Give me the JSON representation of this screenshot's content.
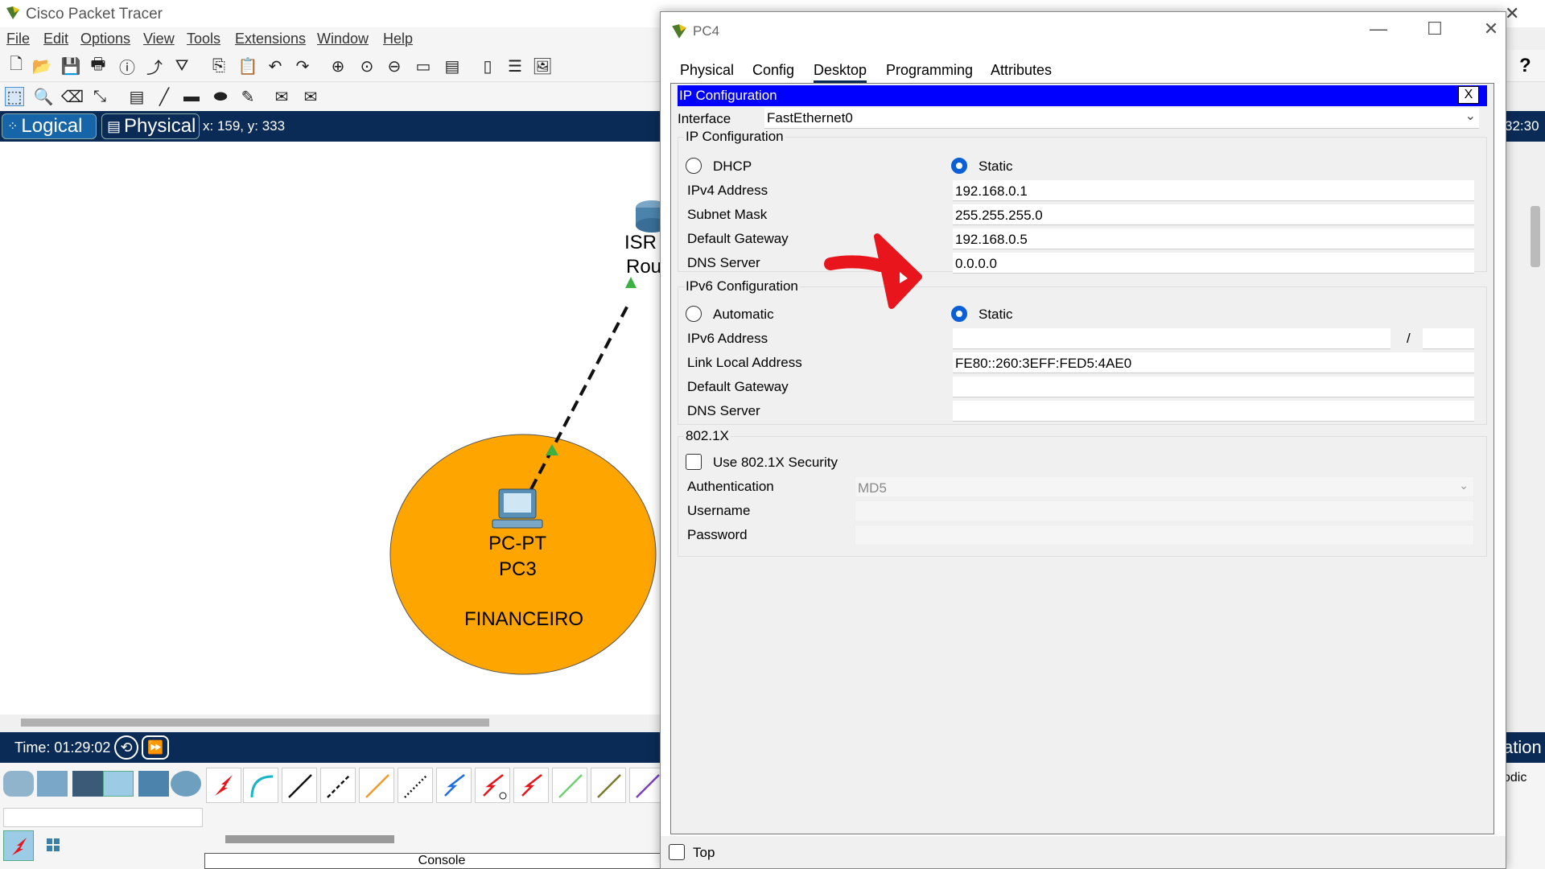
{
  "app": {
    "title": "Cisco Packet Tracer",
    "close_icon": "✕"
  },
  "menu": [
    "File",
    "Edit",
    "Options",
    "View",
    "Tools",
    "Extensions",
    "Window",
    "Help"
  ],
  "help_icon": "?",
  "modes": {
    "logical": "Logical",
    "physical": "Physical",
    "coordinates": "x: 159, y: 333",
    "clock": "32:30"
  },
  "workspace": {
    "device_model": "PC-PT",
    "device_name": "PC3",
    "zone_label": "FINANCEIRO",
    "router_label_line1": "ISR",
    "router_label_line2": "Rou",
    "zone_color": "#ffa500",
    "link_color": "#111111",
    "link_status_color": "#3cb043"
  },
  "simulation": {
    "time": "Time: 01:29:02",
    "right_tab_partial": "ation",
    "right_partial_2": "odic"
  },
  "bottom": {
    "console_label": "Console"
  },
  "pc4": {
    "title": "PC4",
    "tabs": [
      "Physical",
      "Config",
      "Desktop",
      "Programming",
      "Attributes"
    ],
    "active_tab": "Desktop",
    "ip_config": {
      "window_title": "IP Configuration",
      "close_label": "X",
      "interface_label": "Interface",
      "interface_value": "FastEthernet0",
      "ipv4": {
        "section": "IP Configuration",
        "dhcp_label": "DHCP",
        "static_label": "Static",
        "mode": "Static",
        "ipv4_address_label": "IPv4 Address",
        "ipv4_address": "192.168.0.1",
        "subnet_mask_label": "Subnet Mask",
        "subnet_mask": "255.255.255.0",
        "default_gateway_label": "Default Gateway",
        "default_gateway": "192.168.0.5",
        "dns_server_label": "DNS Server",
        "dns_server": "0.0.0.0"
      },
      "ipv6": {
        "section": "IPv6 Configuration",
        "automatic_label": "Automatic",
        "static_label": "Static",
        "mode": "Static",
        "ipv6_address_label": "IPv6 Address",
        "ipv6_address": "",
        "prefix_separator": "/",
        "prefix_length": "",
        "link_local_label": "Link Local Address",
        "link_local": "FE80::260:3EFF:FED5:4AE0",
        "default_gateway_label": "Default Gateway",
        "default_gateway": "",
        "dns_server_label": "DNS Server",
        "dns_server": ""
      },
      "dot1x": {
        "section": "802.1X",
        "use_label": "Use 802.1X Security",
        "use_checked": false,
        "authentication_label": "Authentication",
        "authentication": "MD5",
        "username_label": "Username",
        "username": "",
        "password_label": "Password",
        "password": ""
      }
    },
    "top_label": "Top",
    "top_checked": false
  },
  "annotation": {
    "color": "#e8161c",
    "icon": "arrow-annotation"
  }
}
